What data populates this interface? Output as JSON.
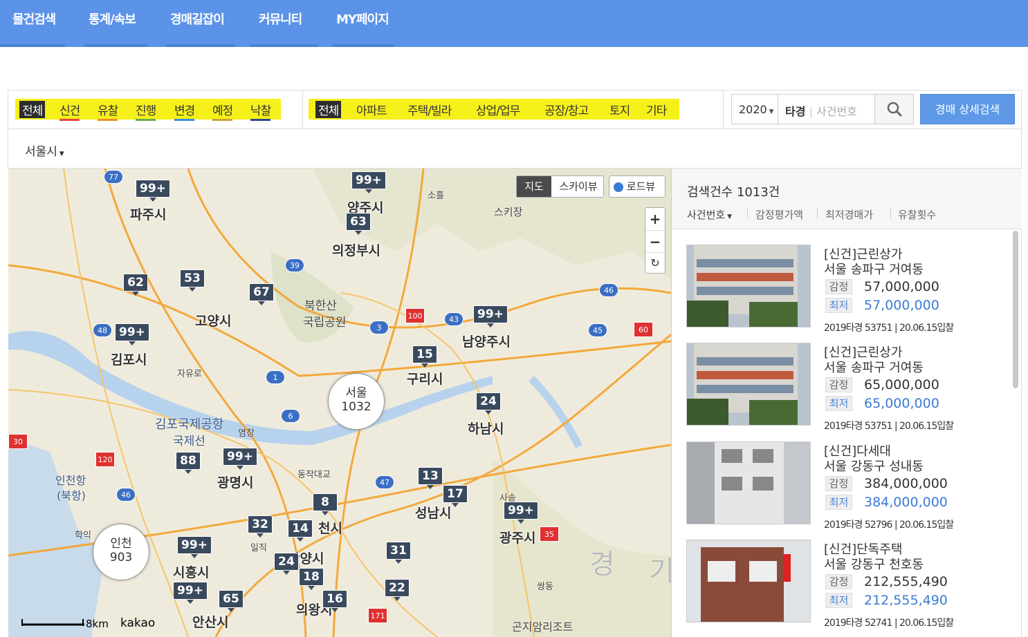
{
  "nav": [
    "물건검색",
    "통계/속보",
    "경매길잡이",
    "커뮤니티",
    "MY페이지"
  ],
  "status_filters": [
    {
      "label": "전체",
      "color": ""
    },
    {
      "label": "신건",
      "color": "#e8453c"
    },
    {
      "label": "유찰",
      "color": "#f08c2a"
    },
    {
      "label": "진행",
      "color": "#6aa84f"
    },
    {
      "label": "변경",
      "color": "#3c8ce0"
    },
    {
      "label": "예정",
      "color": "#c9a13a"
    },
    {
      "label": "낙찰",
      "color": "#2a4a8c"
    }
  ],
  "type_filters": [
    "전체",
    "아파트",
    "주택/빌라",
    "상업/업무",
    "공장/창고",
    "토지",
    "기타"
  ],
  "search": {
    "year": "2020",
    "court_label": "타경",
    "case_placeholder": "사건번호",
    "detail_button": "경매 상세검색"
  },
  "region": {
    "label": "서울시"
  },
  "map": {
    "view_map": "지도",
    "view_sky": "스카이뷰",
    "roadview": "로드뷰",
    "scale": "8km",
    "brand": "kakao",
    "cluster_seoul": {
      "name": "서울",
      "count": "1032"
    },
    "cluster_incheon": {
      "name": "인천",
      "count": "903"
    },
    "markers": [
      "99+",
      "99+",
      "63",
      "62",
      "53",
      "67",
      "99+",
      "99+",
      "15",
      "24",
      "88",
      "99+",
      "8",
      "13",
      "17",
      "99+",
      "32",
      "14",
      "99+",
      "24",
      "18",
      "31",
      "99+",
      "65",
      "16",
      "22"
    ],
    "towns": [
      "파주시",
      "양주시",
      "의정부시",
      "고양시",
      "남양주시",
      "김포시",
      "구리시",
      "하남시",
      "광명시",
      "성남시",
      "광주시",
      "시흥시",
      "안산시",
      "의왕시",
      "천시",
      "안양시"
    ],
    "places": [
      "북한산",
      "국립공원",
      "스키장",
      "소흘",
      "자유로",
      "김포국제공항",
      "국제선",
      "염창",
      "동작대교",
      "인천항",
      "(북항)",
      "학익",
      "일직",
      "사송",
      "쌍동",
      "곤지암리조트",
      "경",
      "기"
    ]
  },
  "results": {
    "count_label": "검색건수 1013건",
    "sort_options": [
      "사건번호",
      "감정평가액",
      "최저경매가",
      "유찰횟수"
    ],
    "appraisal_label": "감정",
    "minimum_label": "최저",
    "items": [
      {
        "title": "[신건]근린상가",
        "address": "서울 송파구 거여동",
        "appraisal": "57,000,000",
        "minimum": "57,000,000",
        "case": "2019타경 53751",
        "date": "20.06.15입찰"
      },
      {
        "title": "[신건]근린상가",
        "address": "서울 송파구 거여동",
        "appraisal": "65,000,000",
        "minimum": "65,000,000",
        "case": "2019타경 53751",
        "date": "20.06.15입찰"
      },
      {
        "title": "[신건]다세대",
        "address": "서울 강동구 성내동",
        "appraisal": "384,000,000",
        "minimum": "384,000,000",
        "case": "2019타경 52796",
        "date": "20.06.15입찰"
      },
      {
        "title": "[신건]단독주택",
        "address": "서울 강동구 천호동",
        "appraisal": "212,555,490",
        "minimum": "212,555,490",
        "case": "2019타경 52741",
        "date": "20.06.15입찰"
      }
    ]
  }
}
